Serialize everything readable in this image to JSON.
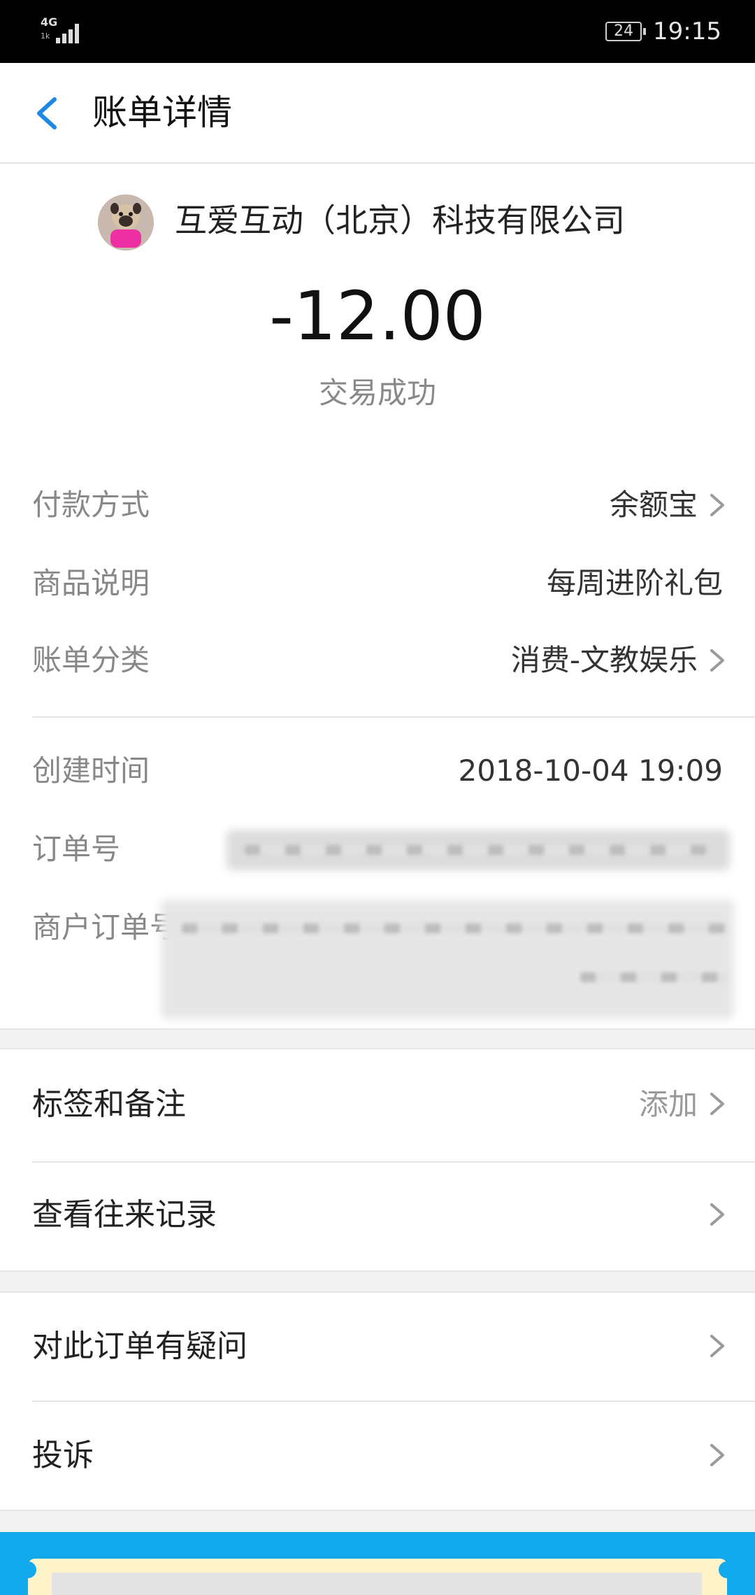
{
  "status_bar": {
    "network": "4G",
    "network_sub": "1k",
    "battery": "24",
    "time": "19:15"
  },
  "header": {
    "title": "账单详情",
    "back_icon": "chevron-left-icon"
  },
  "merchant": {
    "name": "互爱互动（北京）科技有限公司",
    "avatar_icon": "merchant-avatar"
  },
  "amount": "-12.00",
  "trade_status": "交易成功",
  "details": {
    "payment_method": {
      "label": "付款方式",
      "value": "余额宝"
    },
    "product_desc": {
      "label": "商品说明",
      "value": "每周进阶礼包"
    },
    "category": {
      "label": "账单分类",
      "value": "消费-文教娱乐"
    },
    "created_time": {
      "label": "创建时间",
      "value": "2018-10-04 19:09"
    },
    "order_no": {
      "label": "订单号"
    },
    "merchant_order_no": {
      "label": "商户订单号"
    }
  },
  "actions": {
    "tags_notes": {
      "label": "标签和备注",
      "extra": "添加"
    },
    "history": {
      "label": "查看往来记录"
    }
  },
  "support": {
    "question": {
      "label": "对此订单有疑问"
    },
    "complaint": {
      "label": "投诉"
    }
  },
  "colors": {
    "accent": "#1e88e5",
    "banner": "#11a8ec",
    "muted": "#888888"
  }
}
